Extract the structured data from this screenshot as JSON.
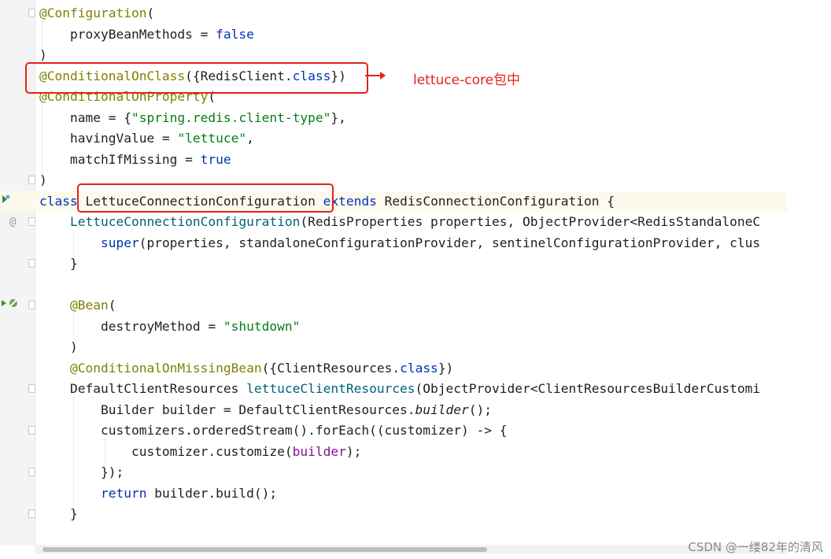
{
  "code": {
    "l1": {
      "ann": "@Configuration",
      "rest": "("
    },
    "l2": {
      "name": "proxyBeanMethods = ",
      "val": "false"
    },
    "l3": {
      "text": ")"
    },
    "l4": {
      "ann": "@ConditionalOnClass",
      "a": "({RedisClient.",
      "kw": "class",
      "b": "})"
    },
    "l5": {
      "ann": "@ConditionalOnProperty",
      "rest": "("
    },
    "l6": {
      "name": "name = {",
      "str": "\"spring.redis.client-type\"",
      "rest": "},"
    },
    "l7": {
      "name": "havingValue = ",
      "str": "\"lettuce\"",
      "rest": ","
    },
    "l8": {
      "name": "matchIfMissing = ",
      "val": "true"
    },
    "l9": {
      "text": ")"
    },
    "l10": {
      "kw1": "class",
      "cls": "LettuceConnectionConfiguration",
      "kw2": "extends",
      "rest": " RedisConnectionConfiguration {"
    },
    "l11": {
      "fn": "LettuceConnectionConfiguration",
      "rest": "(RedisProperties properties, ObjectProvider<RedisStandaloneC"
    },
    "l12": {
      "kw": "super",
      "rest": "(properties, standaloneConfigurationProvider, sentinelConfigurationProvider, clus"
    },
    "l13": {
      "text": "}"
    },
    "l15": {
      "ann": "@Bean",
      "rest": "("
    },
    "l16": {
      "name": "destroyMethod = ",
      "str": "\"shutdown\""
    },
    "l17": {
      "text": ")"
    },
    "l18": {
      "ann": "@ConditionalOnMissingBean",
      "a": "({ClientResources.",
      "kw": "class",
      "b": "})"
    },
    "l19": {
      "type": "DefaultClientResources ",
      "fn": "lettuceClientResources",
      "rest": "(ObjectProvider<ClientResourcesBuilderCustomi"
    },
    "l20": {
      "a": "Builder builder = DefaultClientResources.",
      "it": "builder",
      "b": "();"
    },
    "l21": {
      "text": "customizers.orderedStream().forEach((customizer) -> {"
    },
    "l22": {
      "a": "customizer.customize(",
      "pur": "builder",
      "b": ");"
    },
    "l23": {
      "text": "});"
    },
    "l24": {
      "kw": "return",
      "rest": " builder.build();"
    },
    "l25": {
      "text": "}"
    }
  },
  "gutter": {
    "at_icon": "@"
  },
  "annotation_note": "lettuce-core包中",
  "watermark": "CSDN @一缕82年的清风",
  "colors": {
    "annotation": "#808000",
    "keyword": "#0033b3",
    "string": "#067d17",
    "method": "#00627a",
    "highlight": "#e2231a"
  },
  "icons": [
    "bean-icon",
    "run-icon",
    "override-icon"
  ]
}
